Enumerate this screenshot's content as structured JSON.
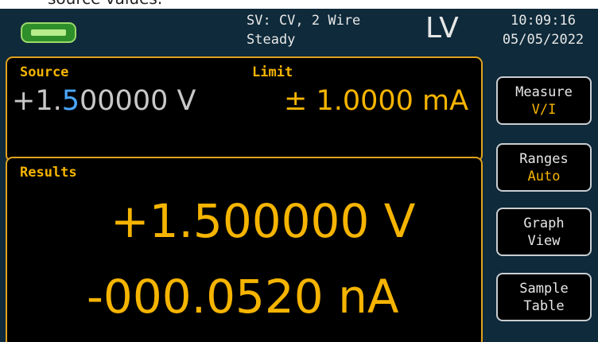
{
  "caption": "source values.",
  "header": {
    "status_line_1": "SV: CV, 2 Wire",
    "status_line_2": "Steady",
    "mode": "LV",
    "time": "10:09:16",
    "date": "05/05/2022"
  },
  "source_panel": {
    "source_label": "Source",
    "limit_label": "Limit",
    "source_value_prefix": "+1.",
    "source_value_highlight": "5",
    "source_value_suffix": "00000 V",
    "limit_value": "± 1.0000 mA"
  },
  "results_panel": {
    "label": "Results",
    "primary_value": "+1.500000 V",
    "secondary_value": "-000.0520 nA"
  },
  "softkeys": [
    {
      "title": "Measure",
      "subtitle": "V/I"
    },
    {
      "title": "Ranges",
      "subtitle": "Auto"
    },
    {
      "title": "Graph",
      "subtitle": "View"
    },
    {
      "title": "Sample",
      "subtitle": "Table"
    }
  ],
  "colors": {
    "background": "#0f2a3a",
    "accent": "#f5b400",
    "highlight_digit": "#4aa8ff",
    "panel_border": "#e0a21f"
  }
}
